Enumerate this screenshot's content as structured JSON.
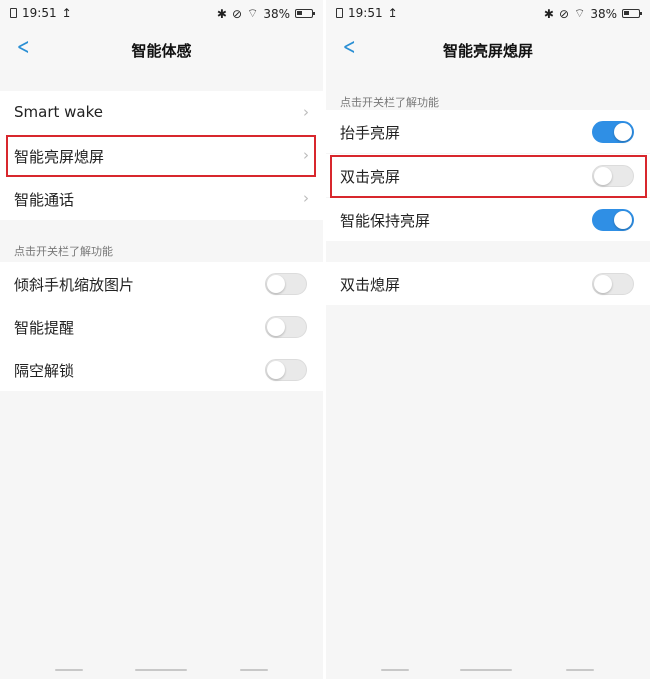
{
  "status": {
    "time": "19:51",
    "upload_glyph": "↥",
    "bluetooth_glyph": "✱",
    "mute_glyph": "⊘",
    "wifi_glyph": "⌔",
    "battery": "38%"
  },
  "left": {
    "back_glyph": "<",
    "title": "智能体感",
    "items": [
      {
        "label": "Smart wake",
        "chevron": "›"
      },
      {
        "label": "智能亮屏熄屏",
        "chevron": "›"
      },
      {
        "label": "智能通话",
        "chevron": "›"
      }
    ],
    "hint": "点击开关栏了解功能",
    "toggles": [
      {
        "label": "倾斜手机缩放图片",
        "on": false
      },
      {
        "label": "智能提醒",
        "on": false
      },
      {
        "label": "隔空解锁",
        "on": false
      }
    ]
  },
  "right": {
    "back_glyph": "<",
    "title": "智能亮屏熄屏",
    "hint": "点击开关栏了解功能",
    "toggles": [
      {
        "label": "抬手亮屏",
        "on": true
      },
      {
        "label": "双击亮屏",
        "on": false
      },
      {
        "label": "智能保持亮屏",
        "on": true
      },
      {
        "label": "双击熄屏",
        "on": false
      }
    ]
  },
  "colors": {
    "accent": "#2f8fe5",
    "highlight": "#d8272d",
    "back": "#2a8fd4"
  }
}
